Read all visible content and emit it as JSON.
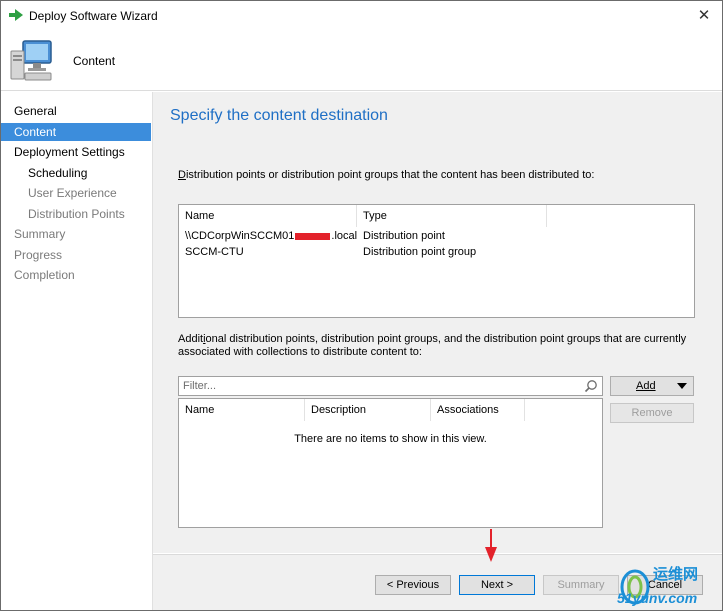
{
  "window": {
    "title": "Deploy Software Wizard",
    "close_glyph": "✕"
  },
  "header": {
    "title": "Content"
  },
  "nav": {
    "items": [
      {
        "label": "General"
      },
      {
        "label": "Content"
      },
      {
        "label": "Deployment Settings"
      },
      {
        "label": "Scheduling"
      },
      {
        "label": "User Experience"
      },
      {
        "label": "Distribution Points"
      },
      {
        "label": "Summary"
      },
      {
        "label": "Progress"
      },
      {
        "label": "Completion"
      }
    ],
    "selected": "Content"
  },
  "main": {
    "title": "Specify the content destination",
    "distributed_label_first": "D",
    "distributed_label_rest": "istribution points or distribution point groups that the content has been distributed to:",
    "distributed_table": {
      "columns": [
        "Name",
        "Type"
      ],
      "rows": [
        {
          "name_prefix": "\\\\CDCorpWinSCCM01",
          "name_suffix": ".local",
          "type": "Distribution point"
        },
        {
          "name": "SCCM-CTU",
          "type": "Distribution point group"
        }
      ]
    },
    "additional_label_pre": "Addit",
    "additional_label_key": "i",
    "additional_label_rest": "onal distribution points, distribution point groups, and the distribution point groups that are currently associated with collections to distribute content to:",
    "filter_placeholder": "Filter...",
    "additional_table": {
      "columns": [
        "Name",
        "Description",
        "Associations"
      ],
      "empty_message": "There are no items to show in this view."
    },
    "add_label": "Add",
    "remove_label": "Remove"
  },
  "footer": {
    "previous_label": "< Previous",
    "next_label": "Next >",
    "summary_label": "Summary",
    "cancel_label": "Cancel"
  },
  "watermark": {
    "text_cn": "运维网",
    "text_url": "51yunv.com"
  },
  "colors": {
    "accent_blue": "#1f6fc5",
    "nav_selected": "#3c8ddc",
    "annotation_red": "#e3222b"
  }
}
